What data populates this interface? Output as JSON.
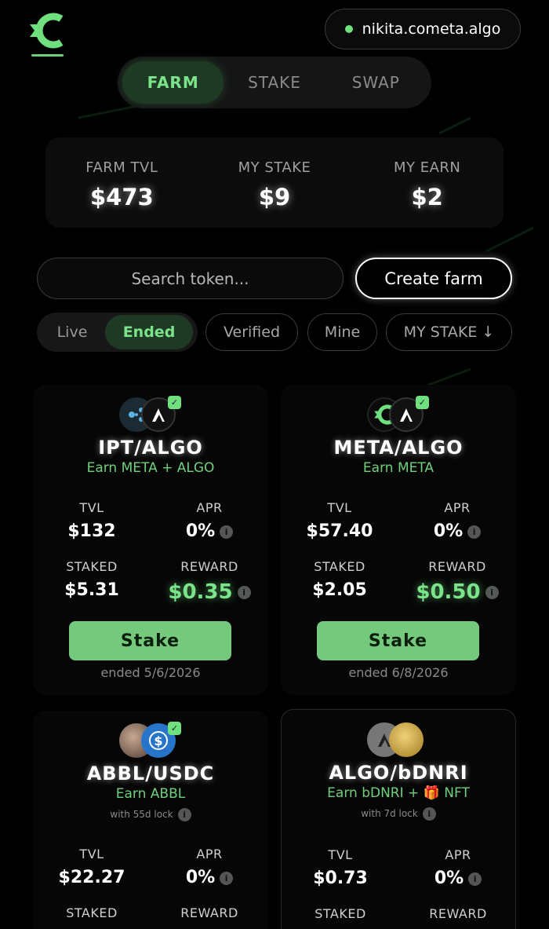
{
  "header": {
    "wallet_address": "nikita.cometa.algo",
    "brand_color": "#6fcf7a"
  },
  "nav": {
    "tabs": [
      {
        "label": "FARM",
        "active": true
      },
      {
        "label": "STAKE",
        "active": false
      },
      {
        "label": "SWAP",
        "active": false
      }
    ]
  },
  "stats": {
    "farm_tvl_label": "FARM TVL",
    "farm_tvl_value": "$473",
    "my_stake_label": "MY STAKE",
    "my_stake_value": "$9",
    "my_earn_label": "MY EARN",
    "my_earn_value": "$2"
  },
  "search": {
    "placeholder": "Search token..."
  },
  "create_farm_label": "Create farm",
  "filters": {
    "live": "Live",
    "ended": "Ended",
    "verified": "Verified",
    "mine": "Mine",
    "sort": "MY STAKE ↓"
  },
  "farms": [
    {
      "pair": "IPT/ALGO",
      "earn": "Earn META + ALGO",
      "tvl_label": "TVL",
      "tvl": "$132",
      "apr_label": "APR",
      "apr": "0%",
      "staked_label": "STAKED",
      "staked": "$5.31",
      "reward_label": "REWARD",
      "reward": "$0.35",
      "button": "Stake",
      "ended": "ended 5/6/2026"
    },
    {
      "pair": "META/ALGO",
      "earn": "Earn META",
      "tvl_label": "TVL",
      "tvl": "$57.40",
      "apr_label": "APR",
      "apr": "0%",
      "staked_label": "STAKED",
      "staked": "$2.05",
      "reward_label": "REWARD",
      "reward": "$0.50",
      "button": "Stake",
      "ended": "ended 6/8/2026"
    },
    {
      "pair": "ABBL/USDC",
      "earn": "Earn ABBL",
      "lock": "with 55d lock",
      "tvl_label": "TVL",
      "tvl": "$22.27",
      "apr_label": "APR",
      "apr": "0%",
      "staked_label": "STAKED",
      "reward_label": "REWARD"
    },
    {
      "pair": "ALGO/bDNRI",
      "earn": "Earn bDNRI + 🎁 NFT",
      "lock": "with 7d lock",
      "tvl_label": "TVL",
      "tvl": "$0.73",
      "apr_label": "APR",
      "apr": "0%",
      "staked_label": "STAKED",
      "reward_label": "REWARD"
    }
  ]
}
